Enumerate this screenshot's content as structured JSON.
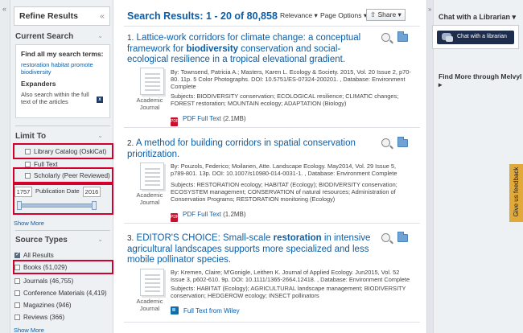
{
  "left_panel": {
    "collapse_icon": "double-chevron-left",
    "refine_title": "Refine Results",
    "current_search": {
      "title": "Current Search",
      "find_label": "Find all my search terms:",
      "terms": "restoration habitat promote biodiversity",
      "expanders_label": "Expanders",
      "expander_text": "Also search within the full text of the articles"
    },
    "limit_to": {
      "title": "Limit To",
      "options": [
        {
          "label": "Library Catalog (OskiCat)"
        },
        {
          "label": "Full Text"
        },
        {
          "label": "Scholarly (Peer Reviewed)"
        }
      ],
      "date_from": "1757",
      "date_label": "Publication Date",
      "date_to": "2016",
      "show_more": "Show More"
    },
    "source_types": {
      "title": "Source Types",
      "options": [
        {
          "label": "All Results"
        },
        {
          "label": "Books (51,029)"
        },
        {
          "label": "Journals (46,755)"
        },
        {
          "label": "Conference Materials (4,419)"
        },
        {
          "label": "Magazines (946)"
        },
        {
          "label": "Reviews (366)"
        }
      ],
      "show_more": "Show More"
    }
  },
  "toolbar": {
    "results_title": "Search Results: 1 - 20 of 80,858",
    "relevance": "Relevance ▾",
    "page_options": "Page Options ▾",
    "share": "Share ▾"
  },
  "results": [
    {
      "num": "1.",
      "title_html_parts": [
        "Lattice-work corridors for climate change: a conceptual framework for ",
        "biodiversity",
        " conservation and social-ecological resilience in a tropical elevational gradient."
      ],
      "type_line1": "Academic",
      "type_line2": "Journal",
      "byline": "By: Townsend, Patricia A.; Masters, Karen L. Ecology & Society. 2015, Vol. 20 Issue 2, p70-80. 11p. 5 Color Photographs. DOI: 10.5751/ES-07324-200201. , Database: Environment Complete",
      "subjects": "Subjects: BIODIVERSITY conservation; ECOLOGICAL resilience; CLIMATIC changes; FOREST restoration; MOUNTAIN ecology; ADAPTATION (Biology)",
      "fulltext": "PDF Full Text",
      "size": "(2.1MB)"
    },
    {
      "num": "2.",
      "title_html_parts": [
        "A method for building corridors in spatial conservation prioritization.",
        "",
        ""
      ],
      "type_line1": "Academic",
      "type_line2": "Journal",
      "byline": "By: Pouzols, Federico; Moilanen, Atte. Landscape Ecology. May2014, Vol. 29 Issue 5, p789-801. 13p. DOI: 10.1007/s10980-014-0031-1. , Database: Environment Complete",
      "subjects": "Subjects: RESTORATION ecology; HABITAT (Ecology); BIODIVERSITY conservation; ECOSYSTEM management; CONSERVATION of natural resources; Administration of Conservation Programs; RESTORATION monitoring (Ecology)",
      "fulltext": "PDF Full Text",
      "size": "(1.2MB)"
    },
    {
      "num": "3.",
      "title_html_parts": [
        "EDITOR'S CHOICE: Small-scale ",
        "restoration",
        " in intensive agricultural landscapes supports more specialized and less mobile pollinator species."
      ],
      "type_line1": "Academic",
      "type_line2": "Journal",
      "byline": "By: Kremen, Claire; M'Gonigle, Leithen K. Journal of Applied Ecology. Jun2015, Vol. 52 Issue 3, p602-610. 9p. DOI: 10.1111/1365-2664.12418. , Database: Environment Complete",
      "subjects": "Subjects: HABITAT (Ecology); AGRICULTURAL landscape management; BIODIVERSITY conservation; HEDGEROW ecology; INSECT pollinators",
      "fulltext": "Full Text from Wiley",
      "size": ""
    }
  ],
  "right_panel": {
    "chat_title": "Chat with a Librarian ▾",
    "chat_button": "Chat with a librarian",
    "melvyl": "Find More through Melvyl ▸"
  },
  "feedback": "Give us feedback",
  "colors": {
    "link": "#0b5ea8",
    "highlight_box": "#d3002b",
    "feedback_tab": "#e0a93a",
    "chat_button": "#1f2d4d"
  }
}
